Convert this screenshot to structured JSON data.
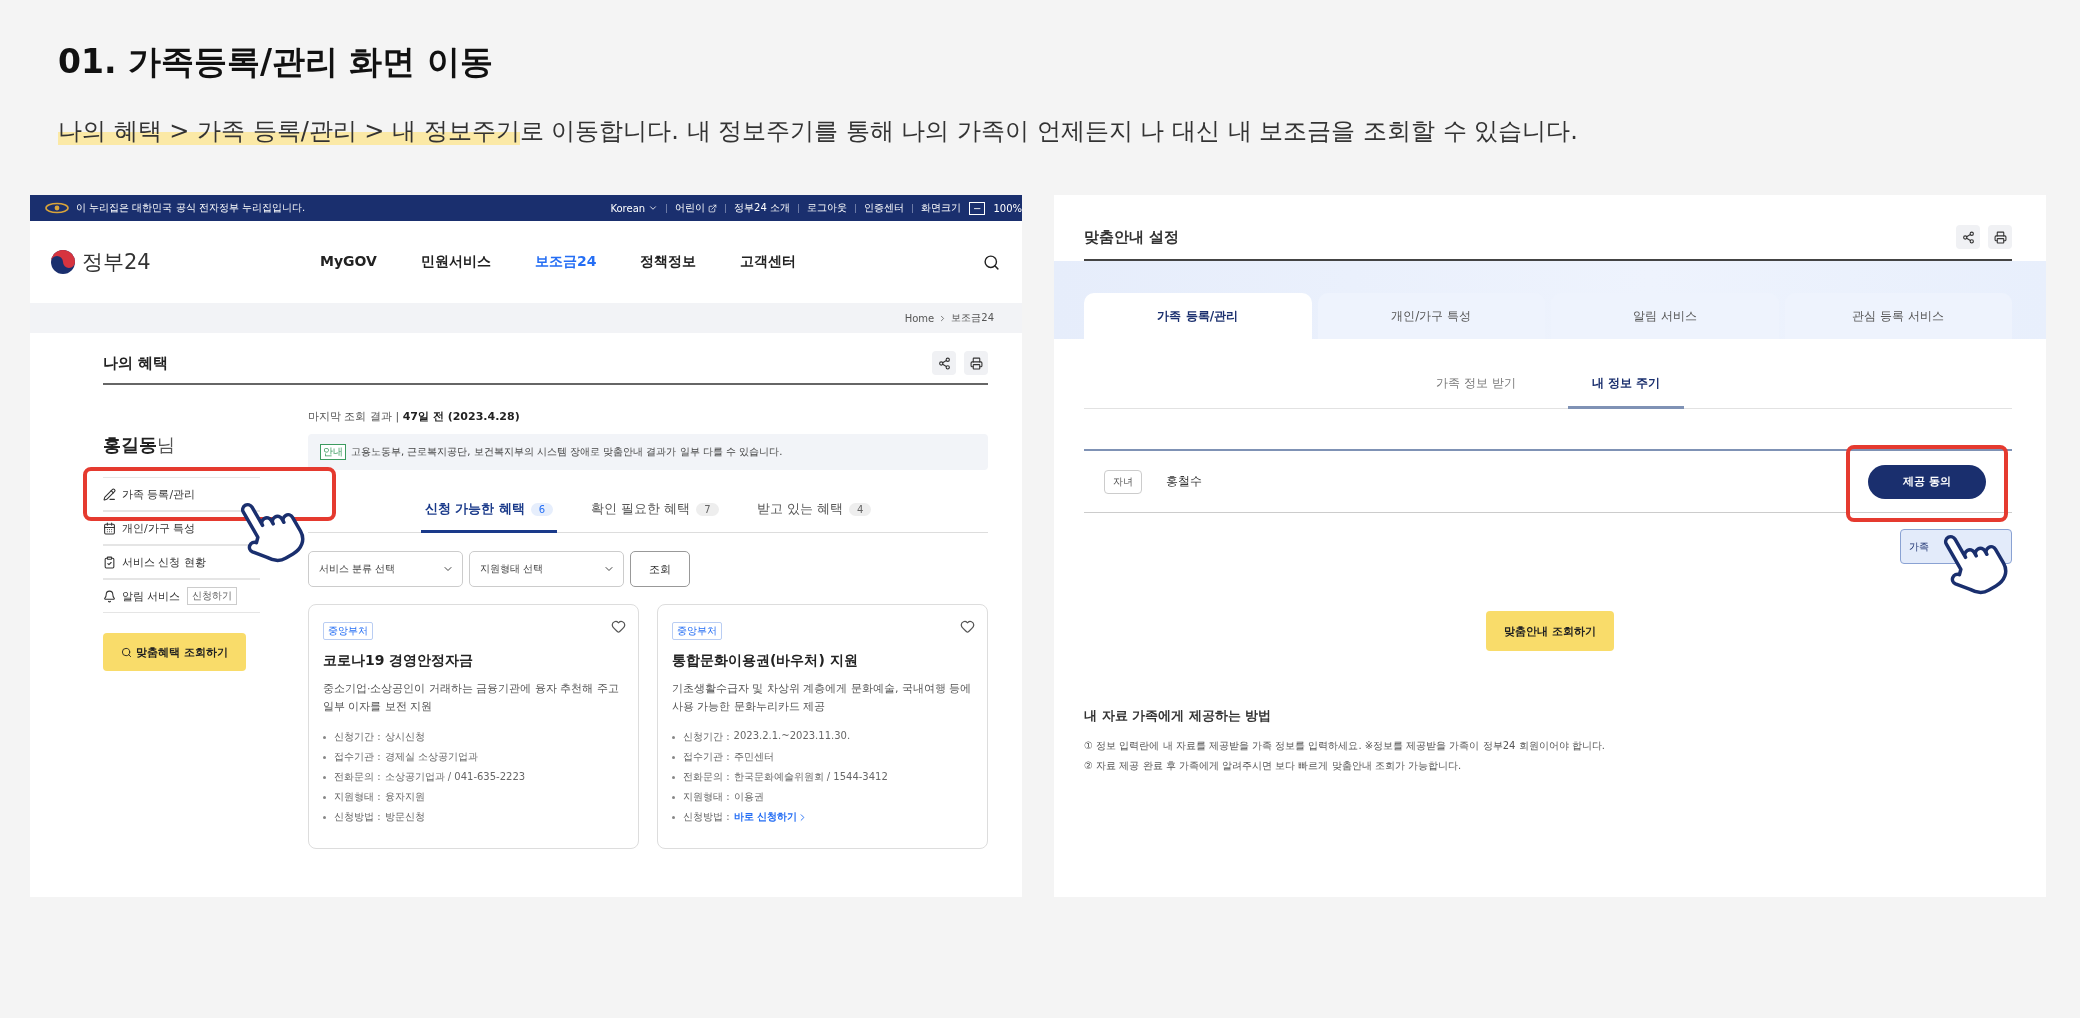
{
  "heading": "01. 가족등록/관리 화면 이동",
  "intro": {
    "highlight": "나의 혜택 > 가족 등록/관리 > 내 정보주기",
    "rest": "로 이동합니다. 내 정보주기를 통해 나의 가족이 언제든지 나 대신 내 보조금을 조회할 수 있습니다."
  },
  "left_screen": {
    "top_bar": {
      "notice": "이 누리집은 대한민국 공식 전자정부 누리집입니다.",
      "links": [
        {
          "label": "Korean",
          "kind": "dropdown"
        },
        {
          "label": "어린이",
          "kind": "external"
        },
        {
          "label": "정부24 소개",
          "kind": "plain"
        },
        {
          "label": "로그아웃",
          "kind": "plain"
        },
        {
          "label": "인증센터",
          "kind": "plain"
        }
      ],
      "zoom_label": "화면크기",
      "zoom_out": "−",
      "zoom_value": "100%"
    },
    "logo": "정부24",
    "nav": [
      {
        "label": "MyGOV",
        "selected": false
      },
      {
        "label": "민원서비스",
        "selected": false
      },
      {
        "label": "보조금24",
        "selected": true
      },
      {
        "label": "정책정보",
        "selected": false
      },
      {
        "label": "고객센터",
        "selected": false
      }
    ],
    "breadcrumb": [
      "Home",
      "보조금24"
    ],
    "page_title": "나의 혜택",
    "user": {
      "name": "홍길동",
      "suffix": "님"
    },
    "menu": [
      {
        "label": "가족 등록/관리",
        "highlighted": true
      },
      {
        "label": "개인/가구 특성",
        "highlighted": false
      },
      {
        "label": "서비스 신청 현황",
        "highlighted": false
      },
      {
        "label": "알림 서비스",
        "badge": "신청하기",
        "highlighted": false
      }
    ],
    "search_button": "맞춤혜택 조회하기",
    "last_check": {
      "label": "마지막 조회 결과",
      "separator": "|",
      "value": "47일 전 (2023.4.28)"
    },
    "notice": {
      "tag": "안내",
      "text": "고용노동부, 근로복지공단, 보건복지부의 시스템 장애로 맞춤안내 결과가 일부 다를 수 있습니다."
    },
    "tabs": [
      {
        "label": "신청 가능한 혜택",
        "count": "6",
        "selected": true
      },
      {
        "label": "확인 필요한 혜택",
        "count": "7",
        "selected": false
      },
      {
        "label": "받고 있는 혜택",
        "count": "4",
        "selected": false
      }
    ],
    "selects": [
      "서비스 분류 선택",
      "지원형태 선택"
    ],
    "query_button": "조회",
    "cards": [
      {
        "tag": "중앙부처",
        "title": "코로나19 경영안정자금",
        "description": "중소기업·소상공인이 거래하는 금융기관에 융자 추천해 주고 일부 이자를 보전 지원",
        "details": [
          {
            "label": "신청기간 :",
            "value": "상시신청",
            "kind": "text"
          },
          {
            "label": "접수기관 :",
            "value": "경제실 소상공기업과",
            "kind": "text"
          },
          {
            "label": "전화문의 :",
            "value": "소상공기업과 / 041-635-2223",
            "kind": "text"
          },
          {
            "label": "지원형태 :",
            "value": "융자지원",
            "kind": "text"
          },
          {
            "label": "신청방법 :",
            "value": "방문신청",
            "kind": "text"
          }
        ]
      },
      {
        "tag": "중앙부처",
        "title": "통합문화이용권(바우처) 지원",
        "description": "기초생활수급자 및 차상위 계층에게 문화예술, 국내여행 등에 사용 가능한 문화누리카드 제공",
        "details": [
          {
            "label": "신청기간 :",
            "value": "2023.2.1.~2023.11.30.",
            "kind": "text"
          },
          {
            "label": "접수기관 :",
            "value": "주민센터",
            "kind": "text"
          },
          {
            "label": "전화문의 :",
            "value": "한국문화예술위원회 / 1544-3412",
            "kind": "text"
          },
          {
            "label": "지원형태 :",
            "value": "이용권",
            "kind": "text"
          },
          {
            "label": "신청방법 :",
            "value": "바로 신청하기",
            "kind": "link"
          }
        ]
      }
    ]
  },
  "right_screen": {
    "title": "맞춤안내 설정",
    "tabs": [
      {
        "label": "가족 등록/관리",
        "selected": true
      },
      {
        "label": "개인/가구 특성",
        "selected": false
      },
      {
        "label": "알림 서비스",
        "selected": false
      },
      {
        "label": "관심 등록 서비스",
        "selected": false
      }
    ],
    "subtabs": [
      {
        "label": "가족 정보 받기",
        "selected": false
      },
      {
        "label": "내 정보 주기",
        "selected": true
      }
    ],
    "family": [
      {
        "relation": "자녀",
        "name": "홍철수",
        "button": "제공 동의",
        "highlighted": true
      }
    ],
    "add_button": "가족",
    "search_button": "맞춤안내 조회하기",
    "guide": {
      "title": "내 자료 가족에게 제공하는 방법",
      "steps": [
        "① 정보 입력란에 내 자료를 제공받을 가족 정보를 입력하세요. ※정보를 제공받을 가족이 정부24 회원이어야 합니다.",
        "② 자료 제공 완료 후 가족에게 알려주시면 보다 빠르게 맞춤안내 조회가 가능합니다."
      ]
    }
  }
}
